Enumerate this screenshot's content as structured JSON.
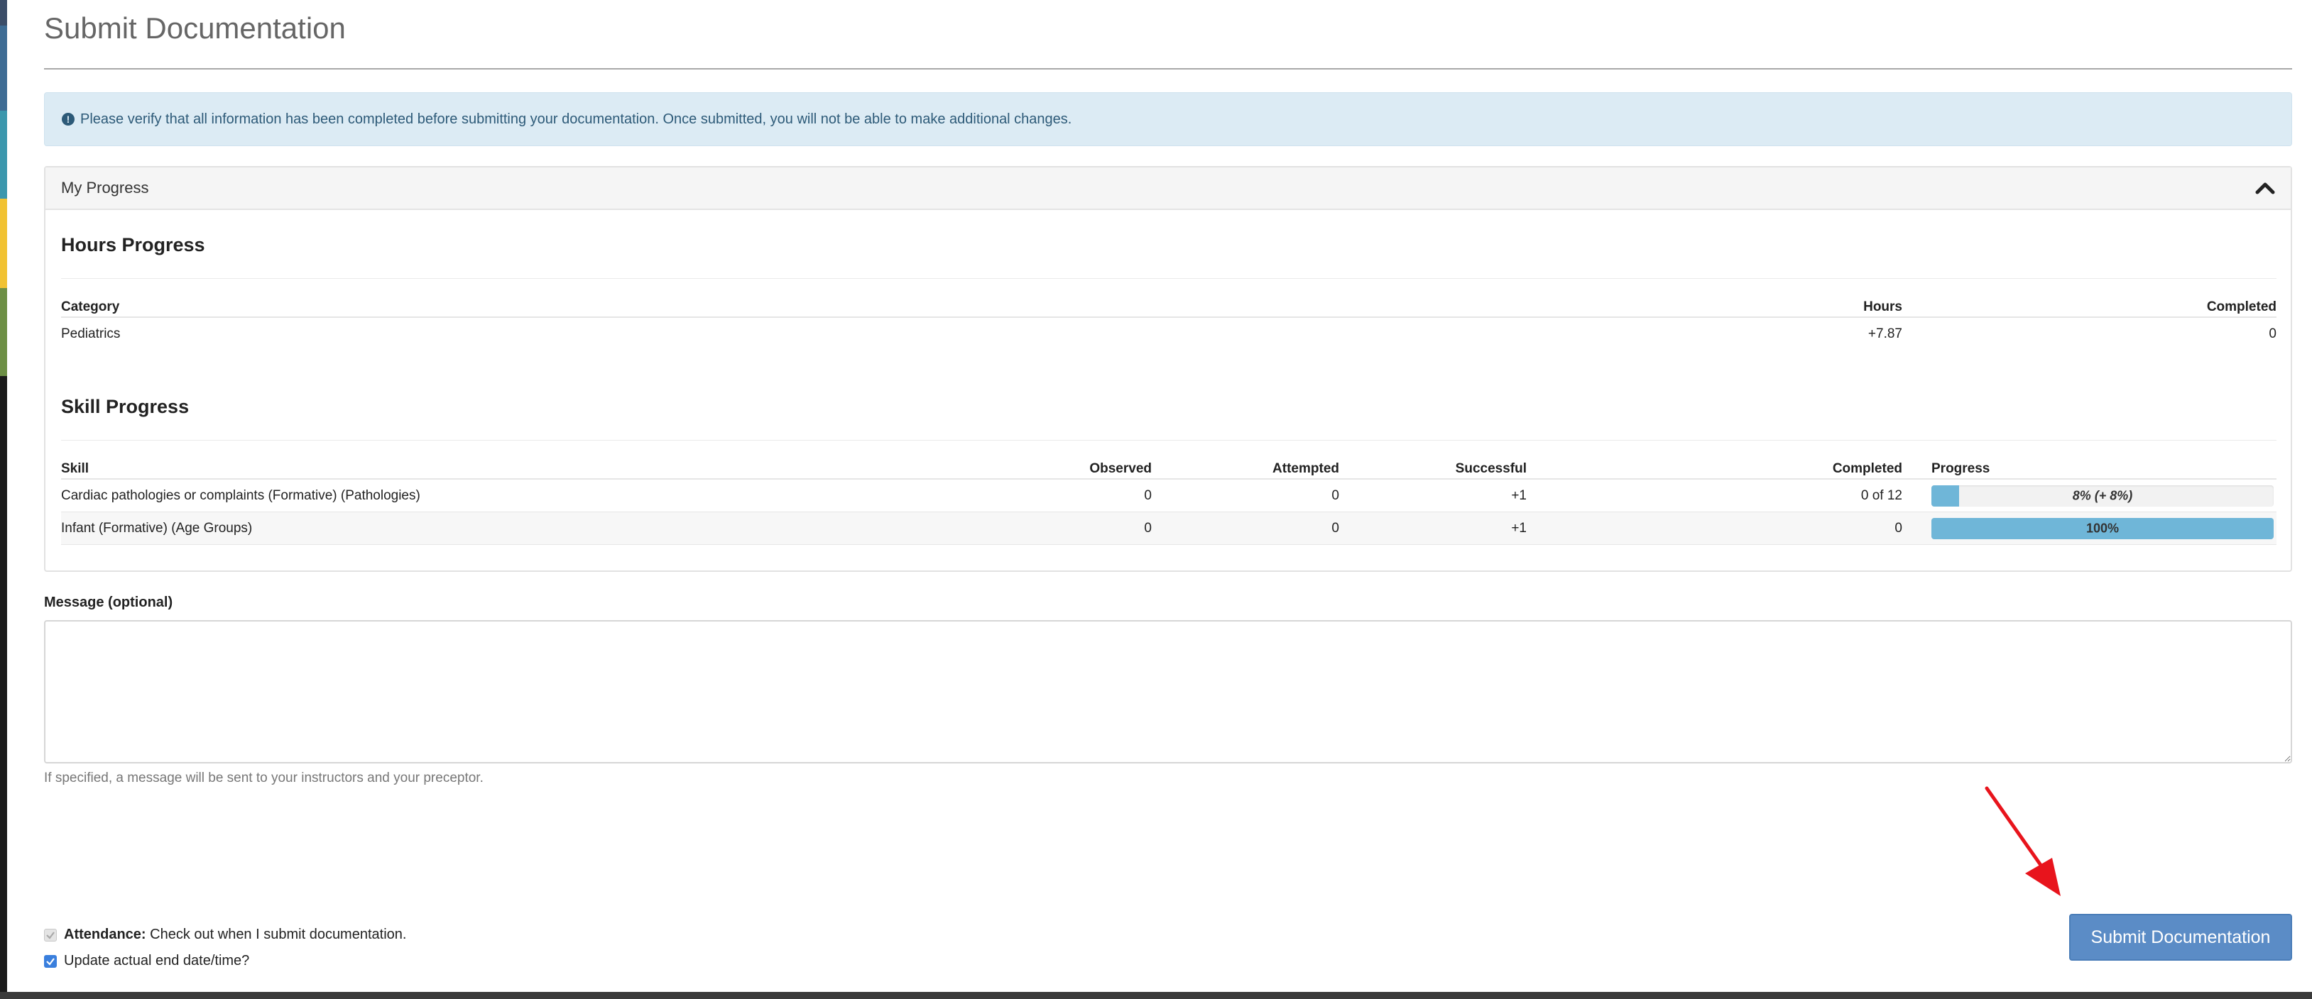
{
  "page": {
    "title": "Submit Documentation"
  },
  "alert": {
    "icon": "exclamation-circle-icon",
    "text": "Please verify that all information has been completed before submitting your documentation. Once submitted, you will not be able to make additional changes."
  },
  "progress_panel": {
    "title": "My Progress",
    "collapse_icon": "chevron-up-icon",
    "hours": {
      "title": "Hours Progress",
      "headers": {
        "category": "Category",
        "hours": "Hours",
        "completed": "Completed"
      },
      "rows": [
        {
          "category": "Pediatrics",
          "hours": "+7.87",
          "completed": "0"
        }
      ]
    },
    "skills": {
      "title": "Skill Progress",
      "headers": {
        "skill": "Skill",
        "observed": "Observed",
        "attempted": "Attempted",
        "successful": "Successful",
        "completed": "Completed",
        "progress": "Progress"
      },
      "rows": [
        {
          "skill": "Cardiac pathologies or complaints (Formative) (Pathologies)",
          "observed": "0",
          "attempted": "0",
          "successful": "+1",
          "completed": "0 of 12",
          "progress_label": "8% (+ 8%)",
          "progress_fraction": 0.08
        },
        {
          "skill": "Infant (Formative) (Age Groups)",
          "observed": "0",
          "attempted": "0",
          "successful": "+1",
          "completed": "0",
          "progress_label": "100%",
          "progress_fraction": 1.0
        }
      ]
    }
  },
  "message": {
    "label": "Message (optional)",
    "value": "",
    "placeholder": "",
    "help": "If specified, a message will be sent to your instructors  and your preceptor."
  },
  "options": {
    "attendance_label": "Attendance:",
    "attendance_text": "Check out when I submit documentation.",
    "attendance_checked": true,
    "attendance_disabled": true,
    "update_end_label": "Update actual end date/time?",
    "update_end_checked": true
  },
  "submit": {
    "label": "Submit Documentation"
  },
  "colors": {
    "accent": "#5b8cc6",
    "progress_fill": "#6fb6d8",
    "alert_bg": "#dcebf4",
    "annotation_arrow": "#e8141c"
  }
}
